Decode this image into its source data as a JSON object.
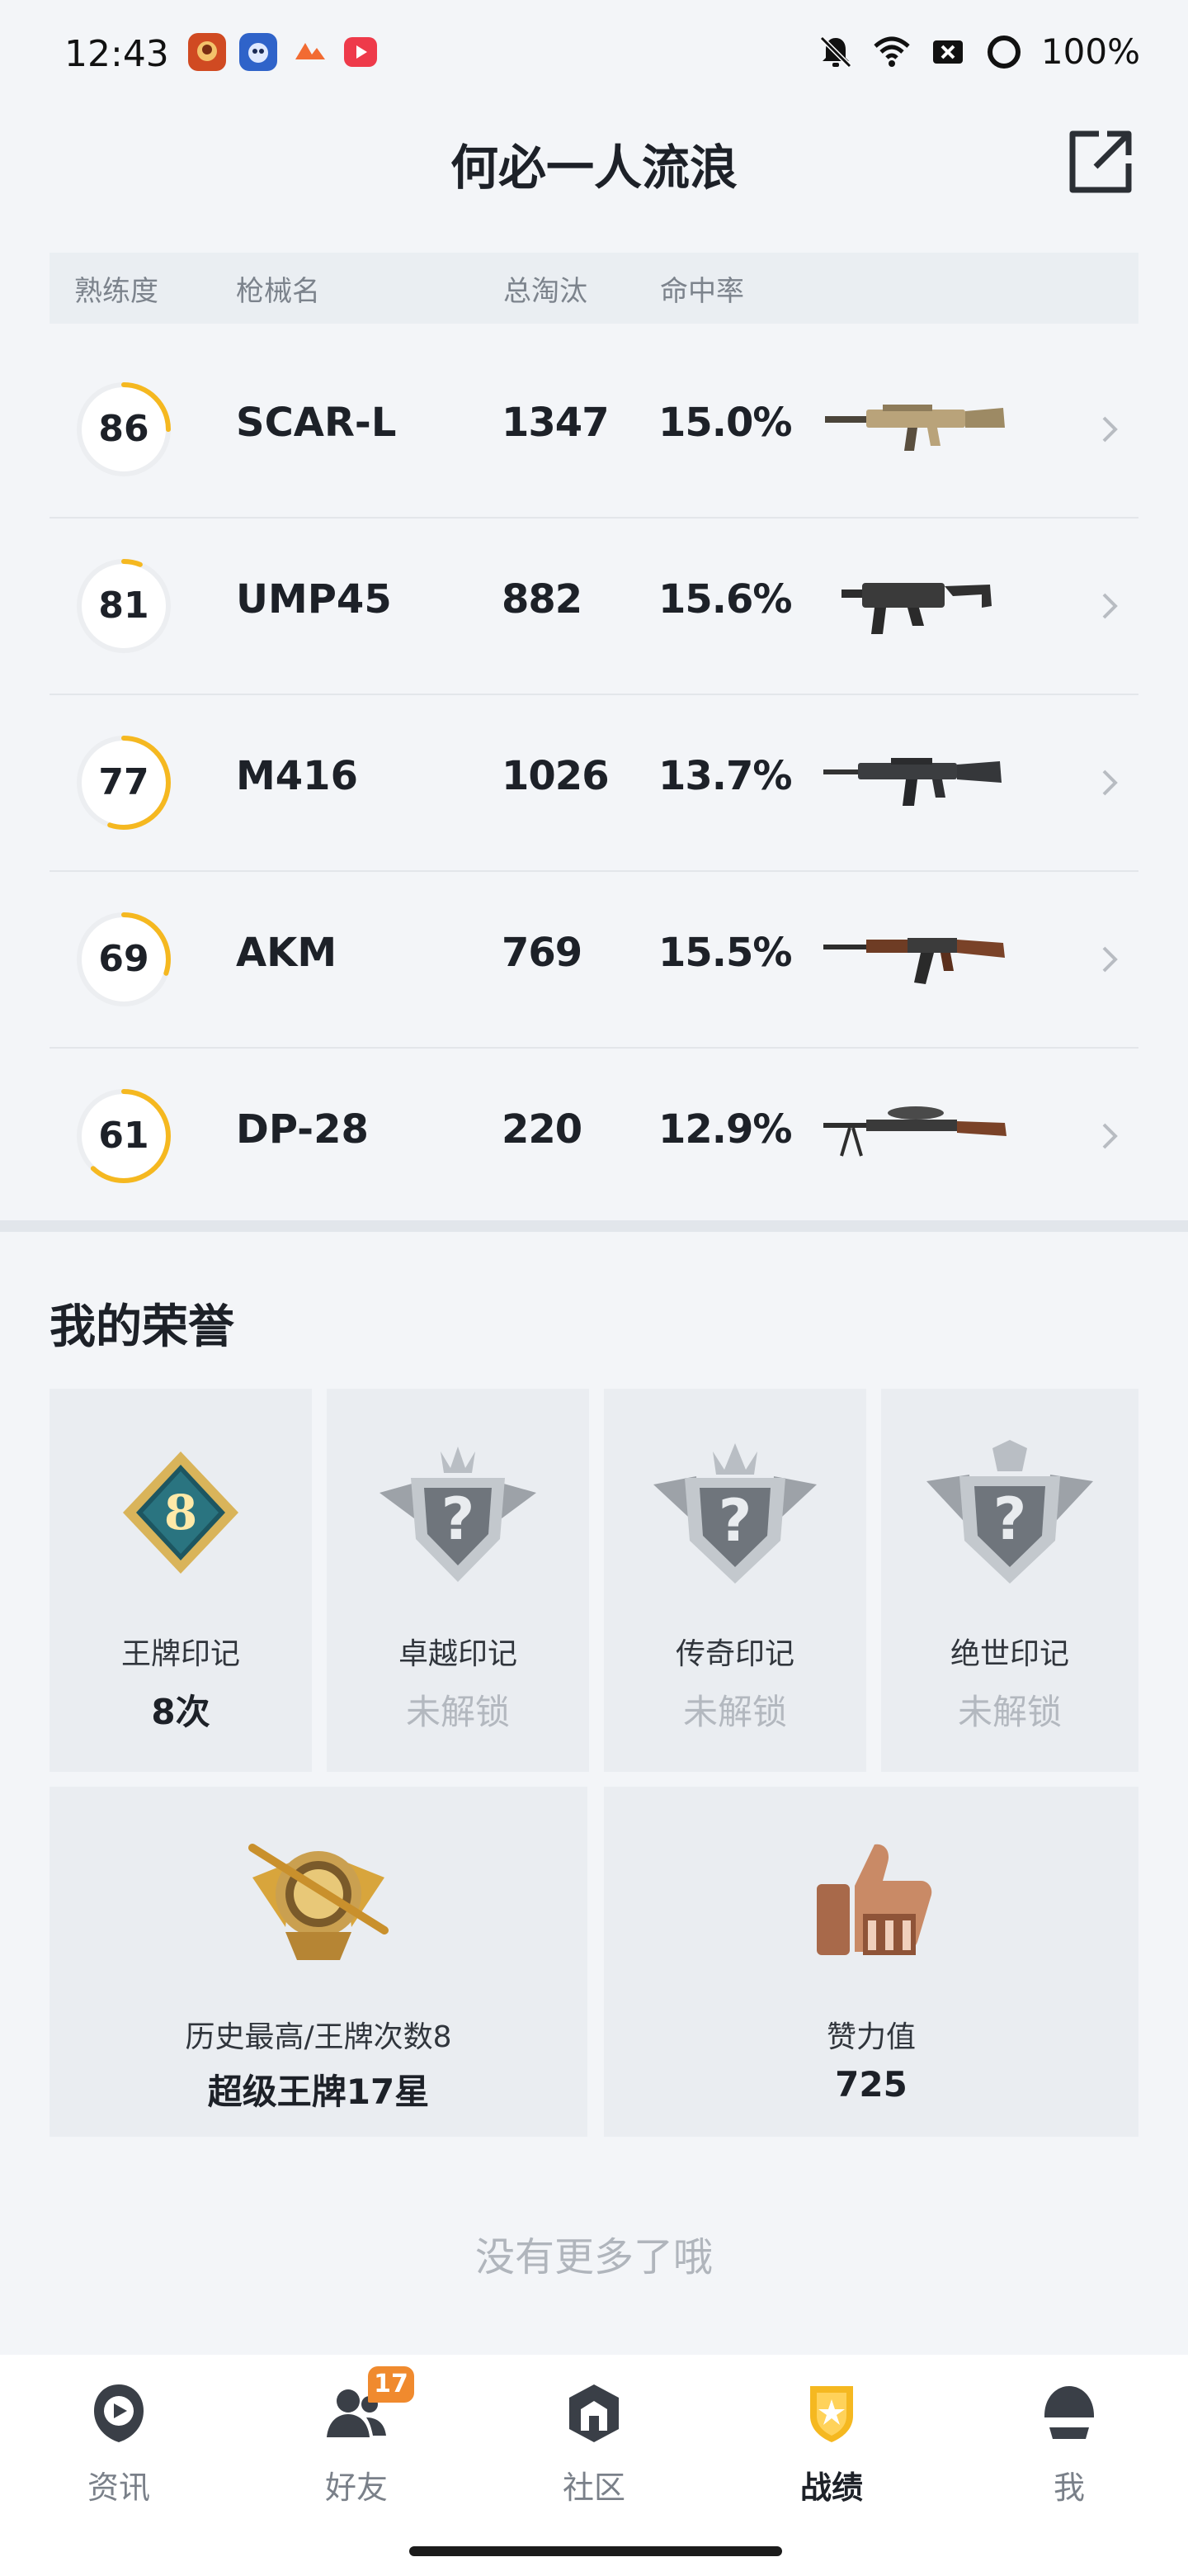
{
  "status_bar": {
    "time": "12:43",
    "battery": "100%"
  },
  "header": {
    "title": "何必一人流浪"
  },
  "table": {
    "headers": {
      "mastery": "熟练度",
      "gun": "枪械名",
      "kills": "总淘汰",
      "accuracy": "命中率"
    },
    "rows": [
      {
        "mastery": "86",
        "gun": "SCAR-L",
        "kills": "1347",
        "accuracy": "15.0%",
        "progress": 0.25
      },
      {
        "mastery": "81",
        "gun": "UMP45",
        "kills": "882",
        "accuracy": "15.6%",
        "progress": 0.06
      },
      {
        "mastery": "77",
        "gun": "M416",
        "kills": "1026",
        "accuracy": "13.7%",
        "progress": 0.55
      },
      {
        "mastery": "69",
        "gun": "AKM",
        "kills": "769",
        "accuracy": "15.5%",
        "progress": 0.3
      },
      {
        "mastery": "61",
        "gun": "DP-28",
        "kills": "220",
        "accuracy": "12.9%",
        "progress": 0.62
      }
    ]
  },
  "honors": {
    "title": "我的荣誉",
    "marks": [
      {
        "label": "王牌印记",
        "value": "8次",
        "badge_number": "8"
      },
      {
        "label": "卓越印记",
        "value": "未解锁"
      },
      {
        "label": "传奇印记",
        "value": "未解锁"
      },
      {
        "label": "绝世印记",
        "value": "未解锁"
      }
    ],
    "best_rank": {
      "label": "历史最高/王牌次数8",
      "value": "超级王牌17星"
    },
    "likes": {
      "label": "赞力值",
      "value": "725"
    }
  },
  "no_more": "没有更多了哦",
  "nav": {
    "items": [
      {
        "label": "资讯"
      },
      {
        "label": "好友",
        "badge": "17"
      },
      {
        "label": "社区"
      },
      {
        "label": "战绩"
      },
      {
        "label": "我"
      }
    ]
  },
  "colors": {
    "accent": "#f5b820",
    "background": "#f3f5f8",
    "badge": "#f08a2e"
  }
}
